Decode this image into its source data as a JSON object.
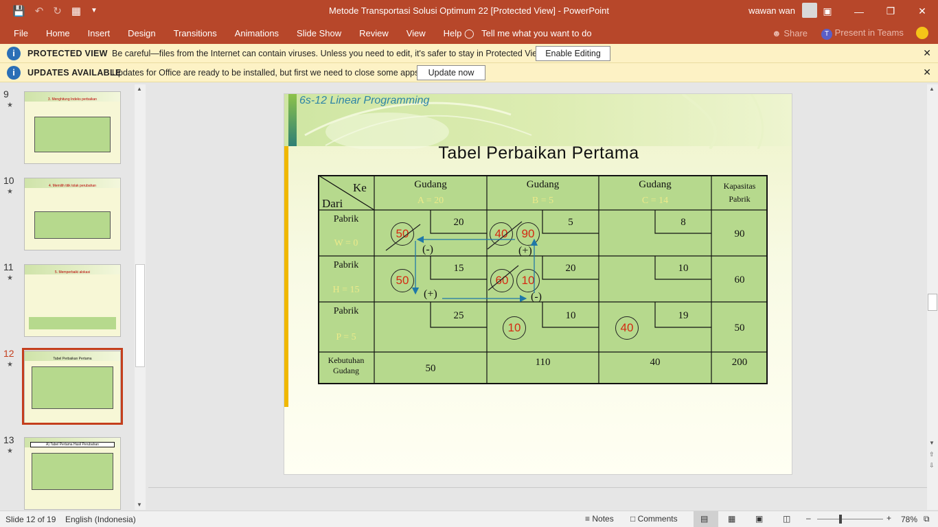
{
  "window": {
    "title": "Metode Transportasi Solusi Optimum 22 [Protected View]  -  PowerPoint",
    "user": "wawan wan"
  },
  "ribbon": {
    "tabs": [
      "File",
      "Home",
      "Insert",
      "Design",
      "Transitions",
      "Animations",
      "Slide Show",
      "Review",
      "View",
      "Help"
    ],
    "tell_me": "Tell me what you want to do",
    "share": "Share",
    "teams": "Present in Teams"
  },
  "protected_bar": {
    "heading": "PROTECTED VIEW",
    "message": "Be careful—files from the Internet can contain viruses. Unless you need to edit, it's safer to stay in Protected View.",
    "button": "Enable Editing"
  },
  "updates_bar": {
    "heading": "UPDATES AVAILABLE",
    "message": "Updates for Office are ready to be installed, but first we need to close some apps.",
    "button": "Update now"
  },
  "thumbnails": [
    {
      "number": "9",
      "title": "3. Menghitung Indeks perbaikan"
    },
    {
      "number": "10",
      "title": "4. Memilih titik tolak perubahan"
    },
    {
      "number": "11",
      "title": "5. Memperbaiki alokasi"
    },
    {
      "number": "12",
      "title": "Tabel Perbaikan Pertama"
    },
    {
      "number": "13",
      "title": "A) Tabel Pertama Hasil Perubahan"
    }
  ],
  "slide": {
    "heading": "6s-12   Linear Programming",
    "title": "Tabel Perbaikan Pertama",
    "corner_ke": "Ke",
    "corner_dari": "Dari",
    "columns": [
      {
        "name": "Gudang",
        "sub": "A   = 20"
      },
      {
        "name": "Gudang",
        "sub": "B   = 5"
      },
      {
        "name": "Gudang",
        "sub": "C   = 14"
      }
    ],
    "capacity_header_1": "Kapasitas",
    "capacity_header_2": "Pabrik",
    "rows": [
      {
        "name": "Pabrik",
        "sub": "W  = 0",
        "costs": [
          "20",
          "5",
          "8"
        ],
        "capacity": "90"
      },
      {
        "name": "Pabrik",
        "sub": "H  = 15",
        "costs": [
          "15",
          "20",
          "10"
        ],
        "capacity": "60"
      },
      {
        "name": "Pabrik",
        "sub": "P  = 5",
        "costs": [
          "25",
          "10",
          "19"
        ],
        "capacity": "50"
      }
    ],
    "demand_label_1": "Kebutuhan",
    "demand_label_2": "Gudang",
    "demand": [
      "50",
      "110",
      "40"
    ],
    "total": "200",
    "allocations": {
      "wa": "50",
      "wb_old": "40",
      "wb_new": "90",
      "ha": "50",
      "hb_old": "60",
      "hb_new": "10",
      "pb": "10",
      "pc": "40"
    },
    "signs": {
      "wa": "(-)",
      "wb": "(+)",
      "ha": "(+)",
      "hb": "(-)"
    }
  },
  "status": {
    "slide": "Slide 12 of 19",
    "language": "English (Indonesia)",
    "notes": "Notes",
    "comments": "Comments",
    "zoom": "78%"
  }
}
